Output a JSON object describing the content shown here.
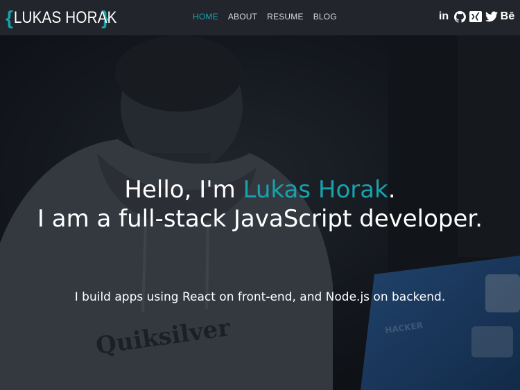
{
  "navbar": {
    "logo_open": "{",
    "logo_name": "LUKAS HORAK",
    "logo_close": "}",
    "links": [
      {
        "label": "HOME",
        "active": true
      },
      {
        "label": "ABOUT",
        "active": false
      },
      {
        "label": "RESUME",
        "active": false
      },
      {
        "label": "BLOG",
        "active": false
      }
    ],
    "social": [
      {
        "icon": "linkedin-icon",
        "glyph": "in"
      },
      {
        "icon": "github-icon"
      },
      {
        "icon": "xing-icon"
      },
      {
        "icon": "twitter-icon"
      },
      {
        "icon": "behance-icon",
        "glyph": "Bē"
      }
    ]
  },
  "hero": {
    "greeting": "Hello, I'm ",
    "name": "Lukas Horak",
    "greeting_end": ".",
    "role_line": "I am a full-stack JavaScript developer.",
    "tagline": "I build apps using React on front-end, and Node.js on backend.",
    "photo_text": [
      "Quiksilver",
      "HACKER"
    ]
  },
  "colors": {
    "accent": "#17a2ad",
    "navbar_bg": "#22262c",
    "text": "#ffffff"
  }
}
